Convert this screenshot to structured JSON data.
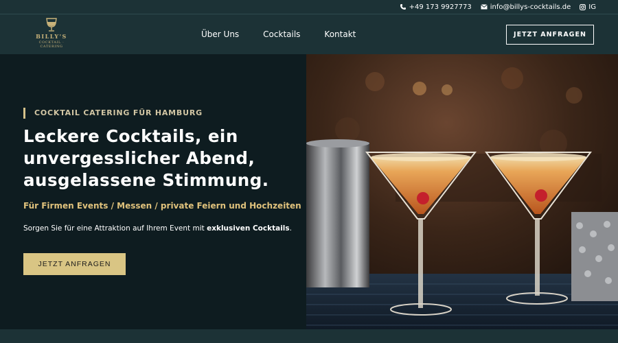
{
  "topbar": {
    "phone": "+49 173 9927773",
    "email": "info@billys-cocktails.de",
    "social": "IG"
  },
  "logo": {
    "name": "BILLY'S",
    "tagline": "COCKTAIL · CATERING"
  },
  "nav": {
    "items": [
      {
        "label": "Über Uns"
      },
      {
        "label": "Cocktails"
      },
      {
        "label": "Kontakt"
      }
    ],
    "cta_label": "JETZT ANFRAGEN"
  },
  "hero": {
    "eyebrow": "COCKTAIL CATERING FÜR HAMBURG",
    "headline_lines": [
      "Leckere Cocktails, ein",
      "unvergesslicher Abend,",
      "ausgelassene Stimmung."
    ],
    "subheadline": "Für Firmen Events / Messen / private Feiern und Hochzeiten",
    "body_prefix": "Sorgen Sie für eine Attraktion auf Ihrem Event mit ",
    "body_bold": "exklusiven Cocktails",
    "body_suffix": ".",
    "cta_label": "JETZT ANFRAGEN"
  },
  "colors": {
    "header_bg": "#1c3236",
    "hero_bg": "#0e1c20",
    "accent_gold": "#d9c584",
    "subheadline_gold": "#e0c27c"
  }
}
